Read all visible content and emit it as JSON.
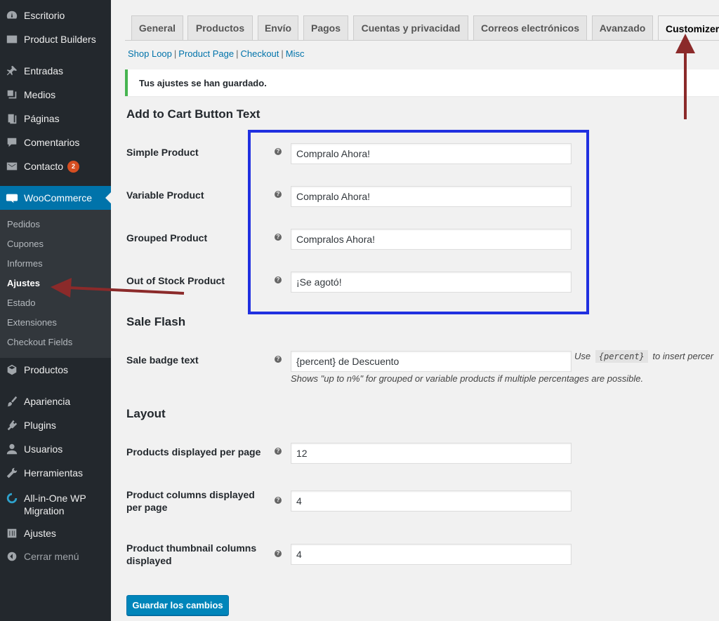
{
  "sidebar": {
    "items": [
      {
        "label": "Escritorio",
        "icon": "dashboard-icon"
      },
      {
        "label": "Product Builders",
        "icon": "builder-icon"
      },
      {
        "label": "Entradas",
        "icon": "pin-icon"
      },
      {
        "label": "Medios",
        "icon": "media-icon"
      },
      {
        "label": "Páginas",
        "icon": "pages-icon"
      },
      {
        "label": "Comentarios",
        "icon": "comment-icon"
      },
      {
        "label": "Contacto",
        "icon": "mail-icon",
        "badge": "2"
      },
      {
        "label": "WooCommerce",
        "icon": "woocommerce-icon"
      },
      {
        "label": "Productos",
        "icon": "cube-icon"
      },
      {
        "label": "Apariencia",
        "icon": "brush-icon"
      },
      {
        "label": "Plugins",
        "icon": "plugin-icon"
      },
      {
        "label": "Usuarios",
        "icon": "user-icon"
      },
      {
        "label": "Herramientas",
        "icon": "wrench-icon"
      },
      {
        "label": "All-in-One WP Migration",
        "icon": "migration-icon"
      },
      {
        "label": "Ajustes",
        "icon": "sliders-icon"
      },
      {
        "label": "Cerrar menú",
        "icon": "collapse-icon"
      }
    ],
    "submenu": [
      "Pedidos",
      "Cupones",
      "Informes",
      "Ajustes",
      "Estado",
      "Extensiones",
      "Checkout Fields"
    ]
  },
  "tabs": [
    "General",
    "Productos",
    "Envío",
    "Pagos",
    "Cuentas y privacidad",
    "Correos electrónicos",
    "Avanzado",
    "Customizer"
  ],
  "subnav": [
    "Shop Loop",
    "Product Page",
    "Checkout",
    "Misc"
  ],
  "notice": "Tus ajustes se han guardado.",
  "sections": {
    "add_to_cart": "Add to Cart Button Text",
    "sale_flash": "Sale Flash",
    "layout": "Layout"
  },
  "fields": {
    "simple": {
      "label": "Simple Product",
      "value": "Compralo Ahora!"
    },
    "variable": {
      "label": "Variable Product",
      "value": "Compralo Ahora!"
    },
    "grouped": {
      "label": "Grouped Product",
      "value": "Compralos Ahora!"
    },
    "out_of_stock": {
      "label": "Out of Stock Product",
      "value": "¡Se agotó!"
    },
    "sale_badge": {
      "label": "Sale badge text",
      "value": "{percent} de Descuento"
    },
    "per_page": {
      "label": "Products displayed per page",
      "value": "12"
    },
    "columns": {
      "label": "Product columns displayed per page",
      "value": "4"
    },
    "thumb_columns": {
      "label": "Product thumbnail columns displayed",
      "value": "4"
    }
  },
  "sale_desc": {
    "pre": "Use",
    "code": "{percent}",
    "post": "to insert percer",
    "below": "Shows \"up to n%\" for grouped or variable products if multiple percentages are possible."
  },
  "help_glyph": "?",
  "save_label": "Guardar los cambios",
  "colors": {
    "accent": "#0073aa",
    "highlight": "#2030e0",
    "arrow": "#8b2a2a",
    "notice_success": "#46b450"
  }
}
